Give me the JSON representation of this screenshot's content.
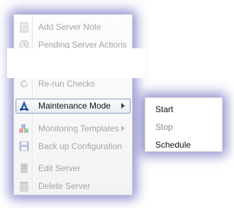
{
  "context_menu": {
    "items": [
      {
        "label": "Add Server Note",
        "icon": "note-icon",
        "enabled": false
      },
      {
        "label": "Pending Server Actions",
        "icon": "clock-icon",
        "enabled": false
      },
      {
        "label": "Re-run Checks",
        "icon": "refresh-icon",
        "enabled": false
      },
      {
        "label": "Maintenance Mode",
        "icon": "maintenance-icon",
        "enabled": true,
        "submenu": true
      },
      {
        "label": "Monitoring Templates",
        "icon": "blocks-icon",
        "enabled": false,
        "submenu": true
      },
      {
        "label": "Back up Configuration",
        "icon": "floppy-icon",
        "enabled": false
      },
      {
        "label": "Edit Server",
        "icon": "edit-icon",
        "enabled": false
      },
      {
        "label": "Delete Server",
        "icon": "trash-icon",
        "enabled": false
      }
    ]
  },
  "submenu": {
    "items": [
      {
        "label": "Start",
        "enabled": true
      },
      {
        "label": "Stop",
        "enabled": false
      },
      {
        "label": "Schedule",
        "enabled": true
      }
    ]
  },
  "colors": {
    "glow": "#3c3caa",
    "active_border": "#8a9fc2",
    "disabled_text": "#a5a5a5"
  }
}
